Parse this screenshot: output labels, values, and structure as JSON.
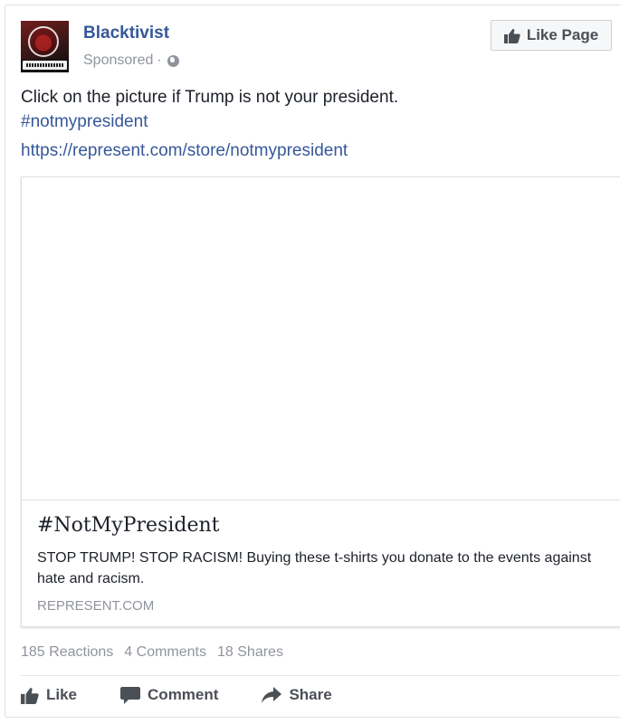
{
  "post": {
    "page_name": "Blacktivist",
    "sponsored_label": "Sponsored",
    "separator": "·",
    "privacy_icon": "globe-icon",
    "like_page_button": "Like Page",
    "text": "Click on the picture if Trump is not your president.",
    "hashtag": "#notmypresident",
    "link_url": "https://represent.com/store/notmypresident"
  },
  "attachment": {
    "title": "#NotMyPresident",
    "description": "STOP TRUMP! STOP RACISM! Buying these t-shirts you donate to the events against hate and racism.",
    "domain": "REPRESENT.COM"
  },
  "stats": {
    "reactions": "185 Reactions",
    "comments": "4 Comments",
    "shares": "18 Shares"
  },
  "actions": {
    "like": "Like",
    "comment": "Comment",
    "share": "Share"
  },
  "colors": {
    "link_blue": "#365899",
    "meta_gray": "#90949c",
    "text_dark": "#1d2129",
    "button_bg": "#f6f7f9"
  }
}
